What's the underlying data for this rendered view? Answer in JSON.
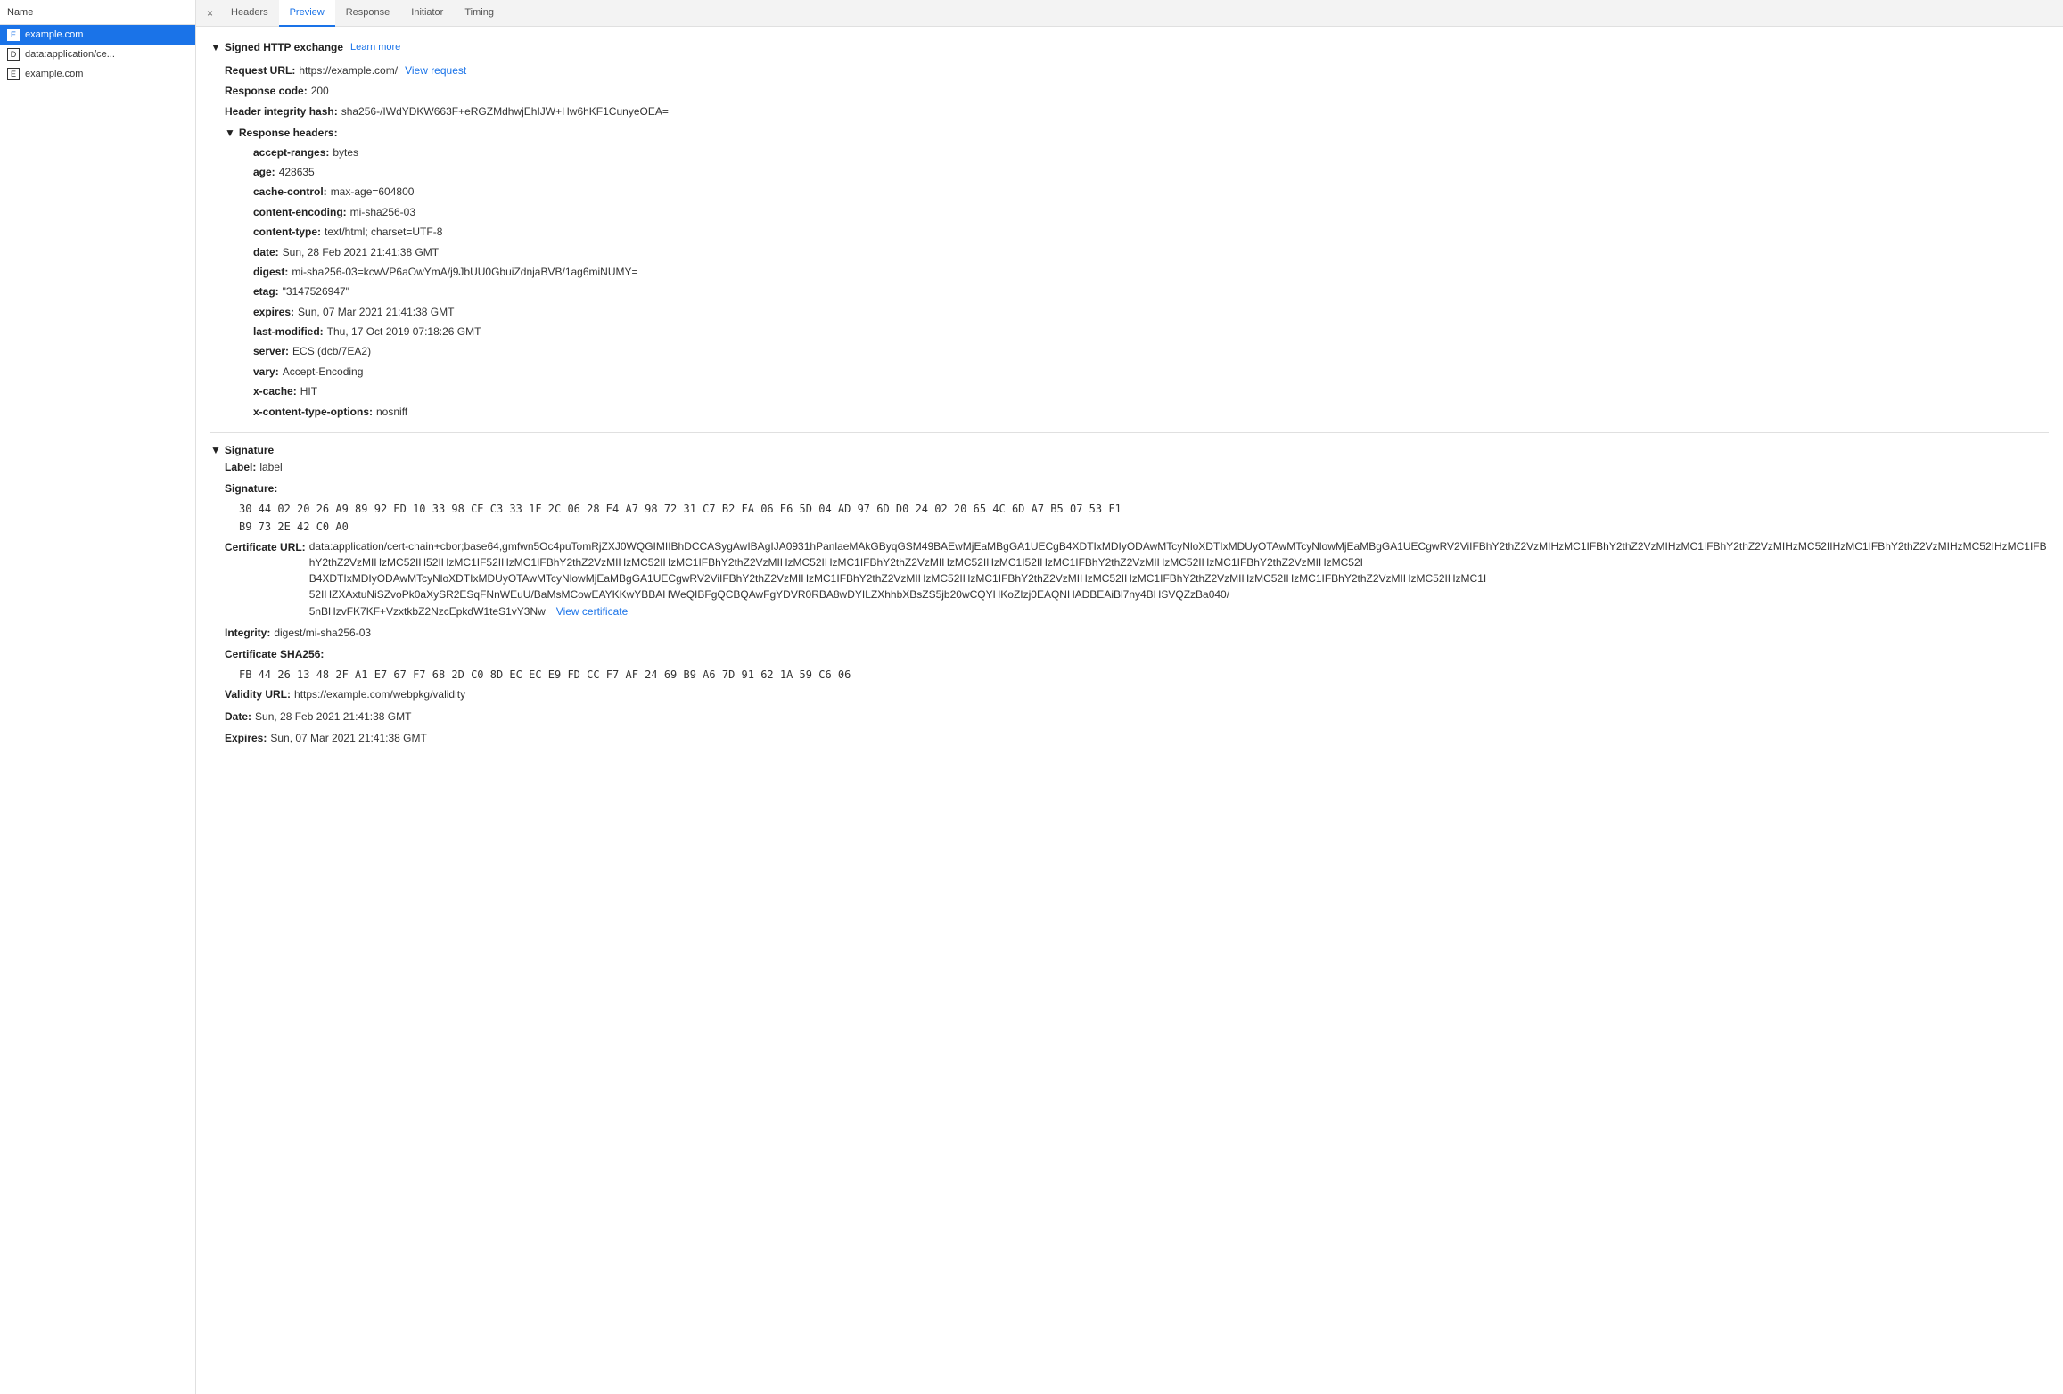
{
  "sidebar": {
    "header": "Name",
    "items": [
      {
        "id": "item-example-com",
        "label": "example.com",
        "icon": "E",
        "active": true
      },
      {
        "id": "item-data-app",
        "label": "data:application/ce...",
        "icon": "D",
        "active": false
      },
      {
        "id": "item-example-com-2",
        "label": "example.com",
        "icon": "E",
        "active": false
      }
    ]
  },
  "tabs": {
    "close_label": "×",
    "items": [
      {
        "id": "tab-headers",
        "label": "Headers",
        "active": false
      },
      {
        "id": "tab-preview",
        "label": "Preview",
        "active": true
      },
      {
        "id": "tab-response",
        "label": "Response",
        "active": false
      },
      {
        "id": "tab-initiator",
        "label": "Initiator",
        "active": false
      },
      {
        "id": "tab-timing",
        "label": "Timing",
        "active": false
      }
    ]
  },
  "content": {
    "signed_http_exchange": {
      "section_title": "Signed HTTP exchange",
      "learn_more_label": "Learn more",
      "request_url_label": "Request URL:",
      "request_url_value": "https://example.com/",
      "view_request_label": "View request",
      "response_code_label": "Response code:",
      "response_code_value": "200",
      "header_integrity_hash_label": "Header integrity hash:",
      "header_integrity_hash_value": "sha256-/IWdYDKW663F+eRGZMdhwjEhIJW+Hw6hKF1CunyeOEA=",
      "response_headers": {
        "section_label": "▼ Response headers:",
        "rows": [
          {
            "key": "accept-ranges:",
            "value": "bytes"
          },
          {
            "key": "age:",
            "value": "428635"
          },
          {
            "key": "cache-control:",
            "value": "max-age=604800"
          },
          {
            "key": "content-encoding:",
            "value": "mi-sha256-03"
          },
          {
            "key": "content-type:",
            "value": "text/html; charset=UTF-8"
          },
          {
            "key": "date:",
            "value": "Sun, 28 Feb 2021 21:41:38 GMT"
          },
          {
            "key": "digest:",
            "value": "mi-sha256-03=kcwVP6aOwYmA/j9JbUU0GbuiZdnjaBVB/1ag6miNUMY="
          },
          {
            "key": "etag:",
            "value": "\"3147526947\""
          },
          {
            "key": "expires:",
            "value": "Sun, 07 Mar 2021 21:41:38 GMT"
          },
          {
            "key": "last-modified:",
            "value": "Thu, 17 Oct 2019 07:18:26 GMT"
          },
          {
            "key": "server:",
            "value": "ECS (dcb/7EA2)"
          },
          {
            "key": "vary:",
            "value": "Accept-Encoding"
          },
          {
            "key": "x-cache:",
            "value": "HIT"
          },
          {
            "key": "x-content-type-options:",
            "value": "nosniff"
          }
        ]
      }
    },
    "signature": {
      "section_title": "▼ Signature",
      "label_label": "Label:",
      "label_value": "label",
      "signature_label": "Signature:",
      "signature_bytes_line1": "30 44 02 20 26 A9 89 92 ED 10 33 98 CE C3 33 1F 2C 06 28 E4 A7 98 72 31 C7 B2 FA 06 E6 5D 04 AD 97 6D D0 24 02 20 65 4C 6D A7 B5 07 53 F1",
      "signature_bytes_line2": "B9 73 2E 42 C0 A0",
      "cert_url_label": "Certificate URL:",
      "cert_url_value": "data:application/cert-chain+cbor;base64,gmfwn5Oc4puTomRjZXJ0WQGIMIIBhDCCASygAwIBAgIJA0931hPanlaeMAkGByqGSM49BAEwMjEaMBgGA1UECgB4XDTIxMDIyODAwMTcyNloXDTIxMDUyOTAwMTcyNlowMjEaMBgGA1UECgwRV2ViIFBhY2thZ2VzMIHzMC1IFBhY2thZ2VzMIHzMC1IFBhY2thZ2VzMIHzMC52IIHzMC1IFBhY2thZ2VzMIHzMC52IHzMC1IFBhY2thZ2VzMIHzMC52IH52IHzMC1IF52IHzMC1IFBhY2thZ2VzMIHzMC52IHzMC1IFBhY2thZ2VzMIHzMC52IHzMC1IFBhY2thZ2VzMIHzMC52IHzMC1I52IHzMC1IFBhY2thZ2VzMIHzMC52IHzMC1IFBhY2thZ2VzMIHzMC52I",
      "cert_url_line2": "B4XDTIxMDIyODAwMTcyNloXDTIxMDUyOTAwMTcyNlowMjEaMBgGA1UECgwRV2ViIFBhY2thZ2VzMIHzMC1IFBhY2thZ2VzMIHzMC52IHzMC1IFBhY2thZ2VzMIHzMC52IHzMC1IFBhY2thZ2VzMIHzMC52IHzMC1IFBhY2thZ2VzMIHzMC52IHzMC1I",
      "cert_url_line3": "52IHZXAxtuNiSZvoPk0aXySR2ESqFNnWEuU/BaMsMCowEAYKKwYBBAHWeQIBFgQCBQAwFgYDVR0RBA8wDYILZXhhbXBsZS5jb20wCQYHKoZIzj0EAQNHADBEAiBl7ny4BHSVQZzBa040/",
      "cert_url_line4": "5nBHzvFK7KF+VzxtkbZ2NzcEpkdW1teS1vY3Nw",
      "view_certificate_label": "View certificate",
      "integrity_label": "Integrity:",
      "integrity_value": "digest/mi-sha256-03",
      "cert_sha256_label": "Certificate SHA256:",
      "cert_sha256_value": "FB 44 26 13 48 2F A1 E7 67 F7 68 2D C0 8D EC EC E9 FD CC F7 AF 24 69 B9 A6 7D 91 62 1A 59 C6 06",
      "validity_url_label": "Validity URL:",
      "validity_url_value": "https://example.com/webpkg/validity",
      "date_label": "Date:",
      "date_value": "Sun, 28 Feb 2021 21:41:38 GMT",
      "expires_label": "Expires:",
      "expires_value": "Sun, 07 Mar 2021 21:41:38 GMT"
    }
  }
}
